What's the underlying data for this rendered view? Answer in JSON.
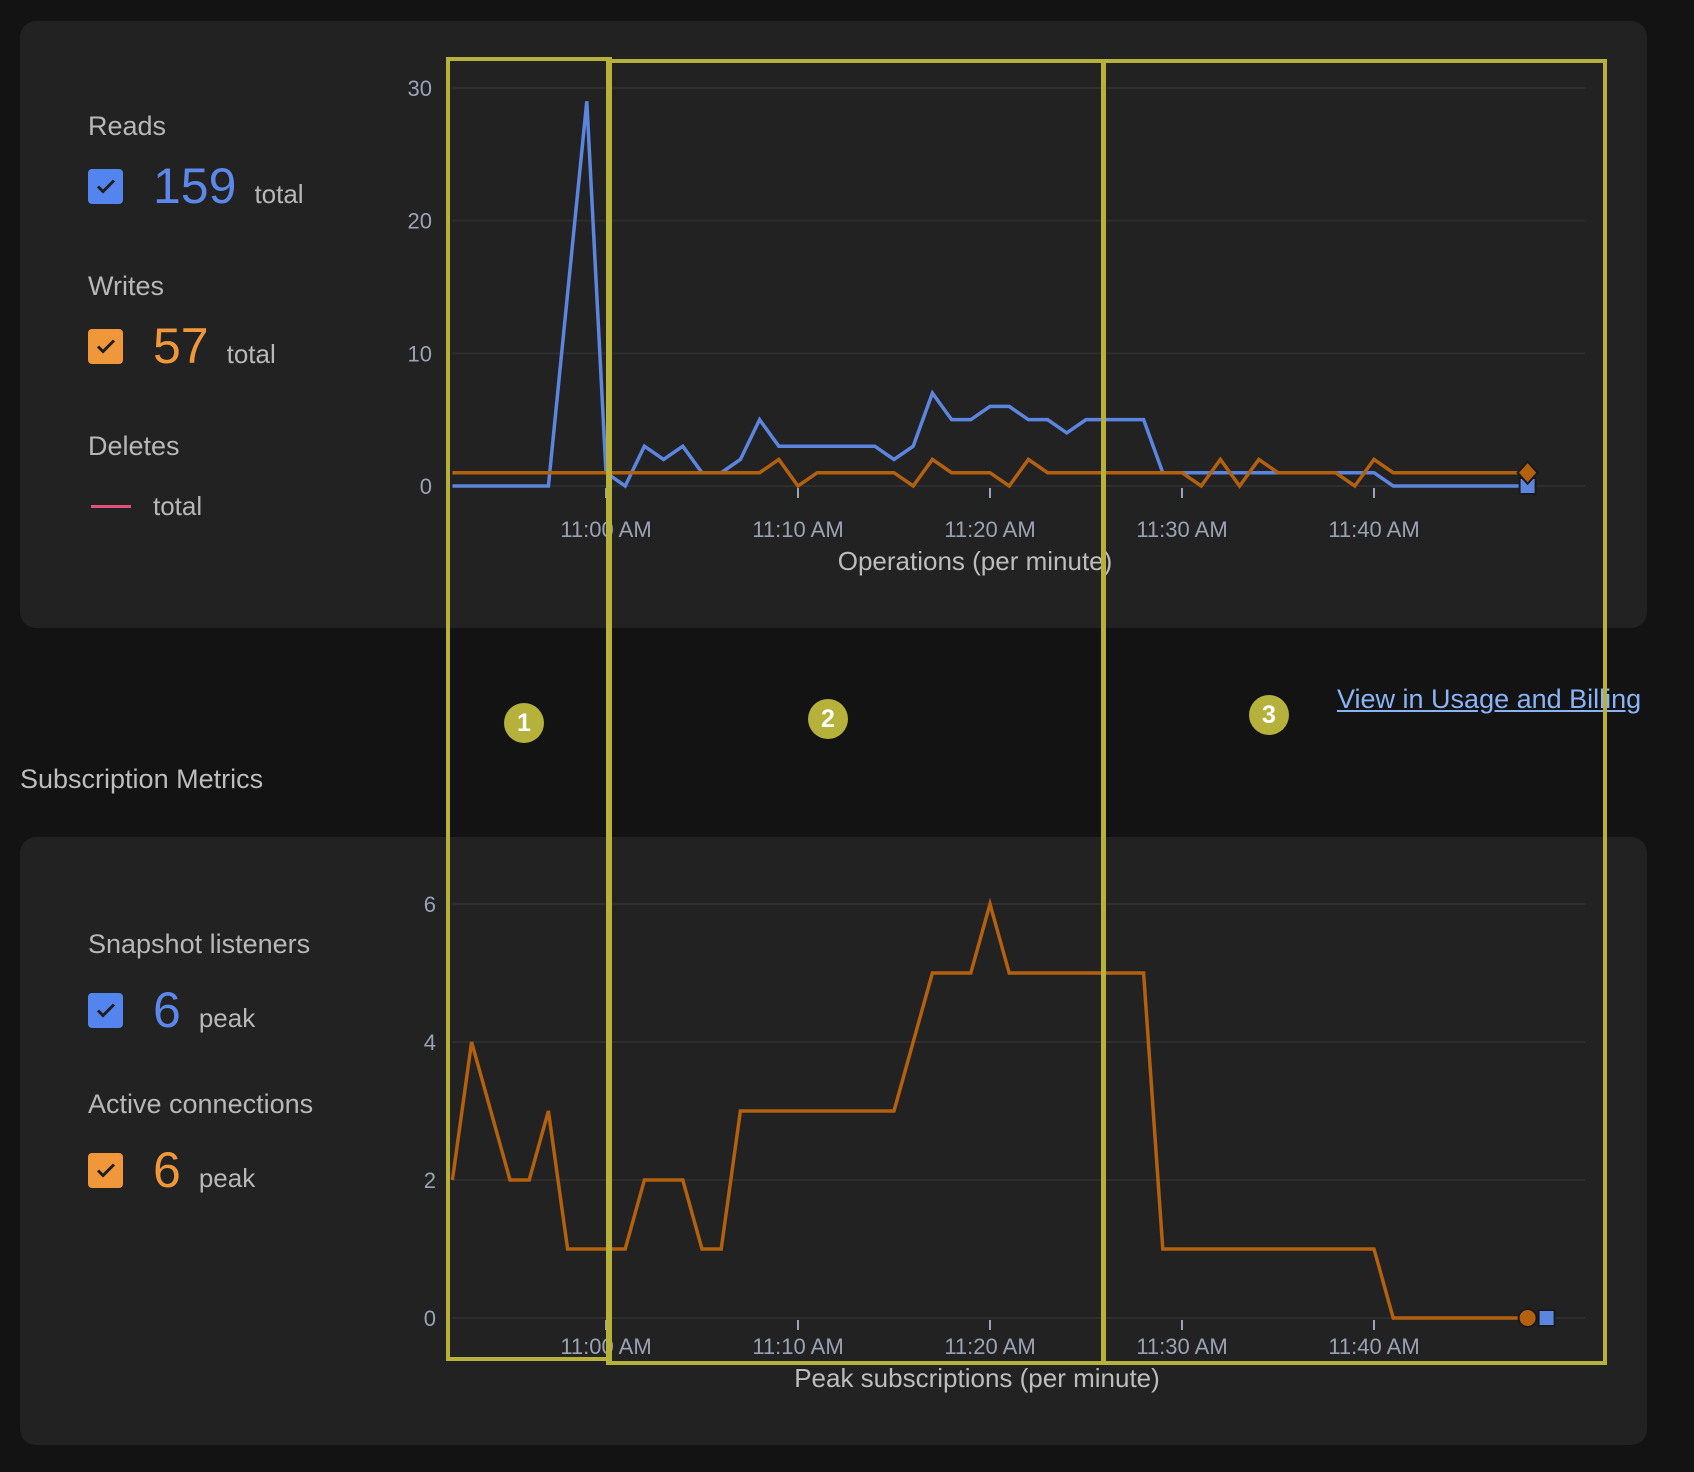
{
  "operations": {
    "legend": [
      {
        "key": "reads",
        "label": "Reads",
        "value": "159",
        "unit": "total",
        "checked": true,
        "color": "#5484ed"
      },
      {
        "key": "writes",
        "label": "Writes",
        "value": "57",
        "unit": "total",
        "checked": true,
        "color": "#f0973a"
      },
      {
        "key": "deletes",
        "label": "Deletes",
        "value": "",
        "unit": "total",
        "checked": false,
        "color": "#e0527a"
      }
    ]
  },
  "link": {
    "label": "View in Usage and Billing"
  },
  "subscriptions": {
    "section_title": "Subscription Metrics",
    "legend": [
      {
        "key": "snapshot",
        "label": "Snapshot listeners",
        "value": "6",
        "unit": "peak",
        "checked": true,
        "color": "#5484ed"
      },
      {
        "key": "connections",
        "label": "Active connections",
        "value": "6",
        "unit": "peak",
        "checked": true,
        "color": "#f0973a"
      }
    ]
  },
  "annotations": {
    "badges": [
      "1",
      "2",
      "3"
    ],
    "color": "#b5b13b"
  },
  "chart_data": [
    {
      "type": "line",
      "title": "",
      "xlabel": "Operations (per minute)",
      "ylabel": "",
      "ylim": [
        0,
        30
      ],
      "yticks": [
        "0",
        "10",
        "20",
        "30"
      ],
      "yticks_values": [
        0,
        10,
        20,
        30
      ],
      "xticks": [
        "11:00 AM",
        "11:10 AM",
        "11:20 AM",
        "11:30 AM",
        "11:40 AM"
      ],
      "xticks_minutes": [
        0,
        10,
        20,
        30,
        40
      ],
      "x_start_minute": -8,
      "x_label_note": "minutes relative to 11:00 AM; one point per minute from 10:52 AM to 11:48 AM",
      "grid": true,
      "series": [
        {
          "name": "Reads",
          "color": "#5b85de",
          "end_marker": "square",
          "values": [
            0,
            0,
            0,
            0,
            0,
            0,
            14.5,
            29,
            1,
            0,
            3,
            2,
            3,
            1,
            1,
            2,
            5,
            3,
            3,
            3,
            3,
            3,
            3,
            2,
            3,
            7,
            5,
            5,
            6,
            6,
            5,
            5,
            4,
            5,
            5,
            5,
            5,
            1,
            1,
            1,
            1,
            1,
            1,
            1,
            1,
            1,
            1,
            1,
            1,
            0,
            0,
            0,
            0,
            0,
            0,
            0,
            0
          ]
        },
        {
          "name": "Writes",
          "color": "#b3600f",
          "end_marker": "diamond",
          "values": [
            1,
            1,
            1,
            1,
            1,
            1,
            1,
            1,
            1,
            1,
            1,
            1,
            1,
            1,
            1,
            1,
            1,
            2,
            0,
            1,
            1,
            1,
            1,
            1,
            0,
            2,
            1,
            1,
            1,
            0,
            2,
            1,
            1,
            1,
            1,
            1,
            1,
            1,
            1,
            0,
            2,
            0,
            2,
            1,
            1,
            1,
            1,
            0,
            2,
            1,
            1,
            1,
            1,
            1,
            1,
            1,
            1
          ]
        },
        {
          "name": "Deletes",
          "color": "#e0527a",
          "values": []
        }
      ]
    },
    {
      "type": "line",
      "title": "",
      "xlabel": "Peak subscriptions (per minute)",
      "ylabel": "",
      "ylim": [
        0,
        6
      ],
      "yticks": [
        "0",
        "2",
        "4",
        "6"
      ],
      "yticks_values": [
        0,
        2,
        4,
        6
      ],
      "xticks": [
        "11:00 AM",
        "11:10 AM",
        "11:20 AM",
        "11:30 AM",
        "11:40 AM"
      ],
      "xticks_minutes": [
        0,
        10,
        20,
        30,
        40
      ],
      "x_start_minute": -8,
      "grid": true,
      "series": [
        {
          "name": "Active connections",
          "color": "#b3600f",
          "end_marker": "circle",
          "values": [
            2,
            4,
            3,
            2,
            2,
            3,
            1,
            1,
            1,
            1,
            2,
            2,
            2,
            1,
            1,
            3,
            3,
            3,
            3,
            3,
            3,
            3,
            3,
            3,
            4,
            5,
            5,
            5,
            6,
            5,
            5,
            5,
            5,
            5,
            5,
            5,
            5,
            1,
            1,
            1,
            1,
            1,
            1,
            1,
            1,
            1,
            1,
            1,
            1,
            0,
            0,
            0,
            0,
            0,
            0,
            0,
            0
          ]
        },
        {
          "name": "Snapshot listeners",
          "color": "#5b85de",
          "end_marker": "square",
          "values": []
        }
      ]
    }
  ]
}
